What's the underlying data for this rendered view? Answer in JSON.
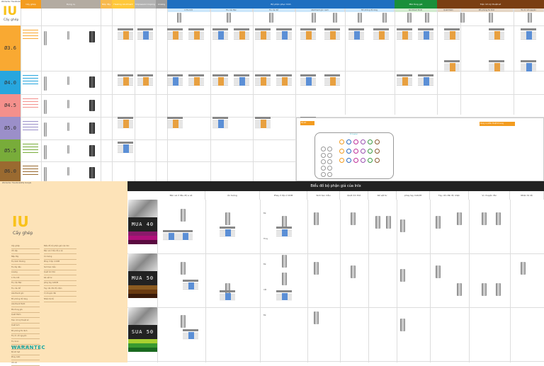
{
  "doc_title": "Warrantec Transferability Google",
  "brand": {
    "logo": "IU",
    "subtitle": "Cấy ghép",
    "company": "WARANTEC"
  },
  "sizes": [
    {
      "label": "Ø3.6",
      "color": "#f9a932"
    },
    {
      "label": "Ø4.0",
      "color": "#27a6de"
    },
    {
      "label": "Ø4.5",
      "color": "#f4908c"
    },
    {
      "label": "Ø5.0",
      "color": "#9b8fc9"
    },
    {
      "label": "Ø5.5",
      "color": "#78ac3a"
    },
    {
      "label": "Ø6.0",
      "color": "#9a6a30"
    }
  ],
  "top_headers": [
    {
      "label": "Cây ghép",
      "color": "#f39c1f"
    },
    {
      "label": "Dụng cụ",
      "color": "#b3aba1"
    },
    {
      "label": "Nắp đậy",
      "color": "#f7b94e"
    },
    {
      "label": "Healing Abutment",
      "color": "#ffc83a"
    },
    {
      "label": "Impression Coping",
      "color": "#b3b3b3"
    },
    {
      "label": "Analog",
      "color": "#9c9c9c"
    },
    {
      "label": "Bộ phận phục hình",
      "color": "#1e6fc0"
    },
    {
      "label": "Mài tùng giả",
      "color": "#1a8f3a"
    },
    {
      "label": "Tiện ích kỹ thuật số",
      "color": "#7a3e12"
    }
  ],
  "sub_headers": [
    "C.Tru Cốt",
    "Trụ cầu Đặc",
    "Trụ cầu Rỗ",
    "Abutment góc cạnh",
    "Mô phỏng độ răng",
    "Abutment Multi",
    "Quét thêm",
    "Mô phỏng fix định",
    "Trụ ốc vít nguyên"
  ],
  "kit": {
    "title": "Bộ kit",
    "tray_label": "Kít Implant",
    "promo_title": "Dụng cụ phẫu thuật bổ sung"
  },
  "prosthetic": {
    "title": "Biểu đồ bộ phận giả của InIx",
    "columns": [
      "Bản vẽ ở đầu độ e xê",
      "Ấn tượng",
      "Phay ở lớp ử CDM",
      "Sinh tạo mẫu",
      "Quét ôm thế",
      "Kế vật tư",
      "phay tạy CAD/M",
      "Tạy cấn đãi độ nhận",
      "Vị chuyện đài",
      "Nhân tâ dễ"
    ],
    "products": [
      {
        "label": "MUA 40",
        "stripes": [
          "#8a1a6a",
          "#b0107a",
          "#5a0a40"
        ]
      },
      {
        "label": "MUA 50",
        "stripes": [
          "#8a5a20",
          "#6a3a10",
          "#3a1a08"
        ]
      },
      {
        "label": "SUA 50",
        "stripes": [
          "#a8d030",
          "#3a9a30",
          "#1a6a20"
        ]
      }
    ],
    "row_labels": [
      "Đế",
      "Thay",
      "Đế",
      "Cắt",
      "Đế"
    ]
  },
  "toc": {
    "left": [
      "Cây ghép",
      "Vít nắp",
      "Nắp đậy",
      "Trụ lành thương",
      "Trụ lấy dấu",
      "Analog",
      "C.Tru Cốt",
      "Trụ cầu Đặc",
      "Trụ cầu Rỗ",
      "Abutment góc",
      "Mô phỏng độ răng",
      "Abutment Multi",
      "Mài tùng giả",
      "Quét thêm",
      "Tiện ích kỹ thuật số",
      "Quét ảnh",
      "Mô phỏng fix định",
      "Trụ ốc vít nguyên",
      "Trụ Scan",
      "Dụng cụ phẫu thuật",
      "Bộ kit hạt",
      "Phay CAD",
      "Vít nối"
    ],
    "right": [
      "Biểu đồ bộ phận giả của InIx",
      "Bản vẽ ở đầu độ e xê",
      "Ấn tượng",
      "Phay ở lớp ử CDM",
      "Sinh tạo mẫu",
      "Quét ôm thế",
      "Kế vật tư",
      "phay tạy CAD/M",
      "Tạy cấn đãi độ nhận",
      "Vị chuyện đài",
      "Nhân tâ dễ"
    ]
  }
}
